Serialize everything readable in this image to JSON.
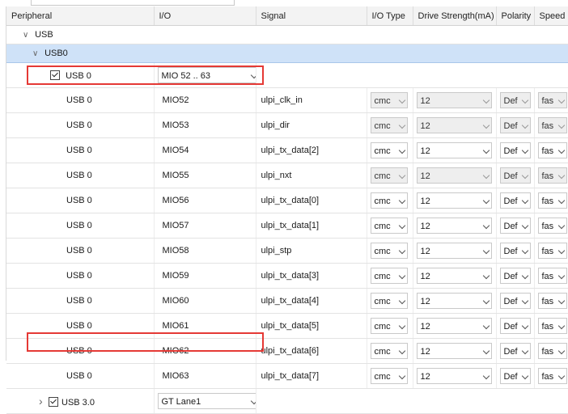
{
  "columns": [
    "Peripheral",
    "I/O",
    "Signal",
    "I/O Type",
    "Drive Strength(mA)",
    "Polarity",
    "Speed"
  ],
  "groups": {
    "usb": "USB",
    "usb0": "USB0"
  },
  "usb0_controller": {
    "label": "USB 0",
    "io_value": "MIO 52 .. 63",
    "checked": true
  },
  "rows": [
    {
      "peripheral": "USB 0",
      "io": "MIO52",
      "signal": "ulpi_clk_in",
      "io_type": "cmc",
      "drive": "12",
      "polarity": "Def",
      "speed": "fas",
      "disabled": true
    },
    {
      "peripheral": "USB 0",
      "io": "MIO53",
      "signal": "ulpi_dir",
      "io_type": "cmc",
      "drive": "12",
      "polarity": "Def",
      "speed": "fas",
      "disabled": true
    },
    {
      "peripheral": "USB 0",
      "io": "MIO54",
      "signal": "ulpi_tx_data[2]",
      "io_type": "cmc",
      "drive": "12",
      "polarity": "Def",
      "speed": "fas",
      "disabled": false
    },
    {
      "peripheral": "USB 0",
      "io": "MIO55",
      "signal": "ulpi_nxt",
      "io_type": "cmc",
      "drive": "12",
      "polarity": "Def",
      "speed": "fas",
      "disabled": true
    },
    {
      "peripheral": "USB 0",
      "io": "MIO56",
      "signal": "ulpi_tx_data[0]",
      "io_type": "cmc",
      "drive": "12",
      "polarity": "Def",
      "speed": "fas",
      "disabled": false
    },
    {
      "peripheral": "USB 0",
      "io": "MIO57",
      "signal": "ulpi_tx_data[1]",
      "io_type": "cmc",
      "drive": "12",
      "polarity": "Def",
      "speed": "fas",
      "disabled": false
    },
    {
      "peripheral": "USB 0",
      "io": "MIO58",
      "signal": "ulpi_stp",
      "io_type": "cmc",
      "drive": "12",
      "polarity": "Def",
      "speed": "fas",
      "disabled": false
    },
    {
      "peripheral": "USB 0",
      "io": "MIO59",
      "signal": "ulpi_tx_data[3]",
      "io_type": "cmc",
      "drive": "12",
      "polarity": "Def",
      "speed": "fas",
      "disabled": false
    },
    {
      "peripheral": "USB 0",
      "io": "MIO60",
      "signal": "ulpi_tx_data[4]",
      "io_type": "cmc",
      "drive": "12",
      "polarity": "Def",
      "speed": "fas",
      "disabled": false
    },
    {
      "peripheral": "USB 0",
      "io": "MIO61",
      "signal": "ulpi_tx_data[5]",
      "io_type": "cmc",
      "drive": "12",
      "polarity": "Def",
      "speed": "fas",
      "disabled": false
    },
    {
      "peripheral": "USB 0",
      "io": "MIO62",
      "signal": "ulpi_tx_data[6]",
      "io_type": "cmc",
      "drive": "12",
      "polarity": "Def",
      "speed": "fas",
      "disabled": false
    },
    {
      "peripheral": "USB 0",
      "io": "MIO63",
      "signal": "ulpi_tx_data[7]",
      "io_type": "cmc",
      "drive": "12",
      "polarity": "Def",
      "speed": "fas",
      "disabled": false
    }
  ],
  "usb3": {
    "label": "USB 3.0",
    "io_value": "GT Lane1",
    "checked": true
  },
  "colors": {
    "selected_row": "#cfe2f8",
    "highlight": "#e53935",
    "header_bg": "#f3f3f3"
  }
}
